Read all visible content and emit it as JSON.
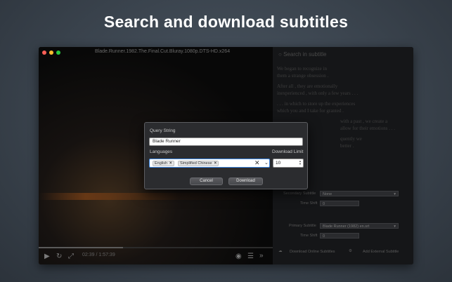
{
  "headline": "Search and download subtitles",
  "window": {
    "title": "Blade.Runner.1982.The.Final.Cut.Bluray.1080p.DTS-HD.x264",
    "traffic_colors": [
      "#fc5f57",
      "#fdbc2e",
      "#28c840"
    ]
  },
  "player": {
    "time": "02:39 / 1:57:39",
    "progress_fraction": 0.36,
    "icons": [
      "play-icon",
      "loop-icon",
      "fullscreen-icon",
      "subtitle-icon",
      "list-icon",
      "forward-icon"
    ]
  },
  "sidebar": {
    "search_placeholder": "Search in subtitle",
    "lines": [
      "We began to recognize in",
      "them a strange obsession .",
      "After all , they are emotionally",
      "inexperienced , with only a few years . . .",
      ". . . in which to store up the experiences",
      "which you and I take for granted .",
      "with a past , we create a",
      "allow for their emotions . . .",
      "quently we",
      "better ."
    ],
    "secondary_subtitle_label": "Secondary Subtitle",
    "secondary_subtitle_value": "None",
    "time_shift_label": "Time Shift",
    "time_shift_value_1": "0",
    "primary_subtitle_label": "Primary Subtitle",
    "primary_subtitle_value": "Blade Runner (1982) en.srt",
    "time_shift_value_2": "0",
    "download_online_label": "Download Online Subtitles",
    "add_external_label": "Add External Subtitle"
  },
  "dialog": {
    "query_label": "Query String",
    "query_value": "Blade Runner",
    "languages_label": "Languages",
    "languages": [
      "English",
      "Simplified Chinese"
    ],
    "download_limit_label": "Download Limit",
    "download_limit_value": "10",
    "cancel_label": "Cancel",
    "download_label": "Download"
  }
}
